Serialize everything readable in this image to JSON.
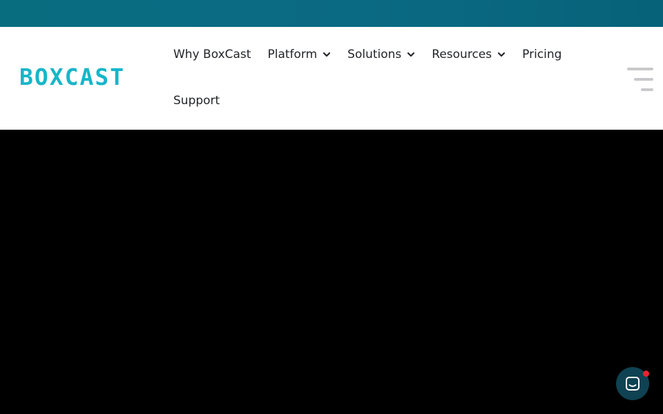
{
  "brand": {
    "logo_text": "BOXCAST",
    "accent_color": "#17b6c9",
    "top_strip_color": "#096d80"
  },
  "nav": {
    "items": [
      {
        "label": "Why BoxCast",
        "has_dropdown": false
      },
      {
        "label": "Platform",
        "has_dropdown": true
      },
      {
        "label": "Solutions",
        "has_dropdown": true
      },
      {
        "label": "Resources",
        "has_dropdown": true
      },
      {
        "label": "Pricing",
        "has_dropdown": false
      },
      {
        "label": "Support",
        "has_dropdown": false
      }
    ]
  },
  "icons": {
    "menu": "hamburger-menu-icon",
    "chat": "chat-bubble-icon",
    "dropdown": "chevron-down-icon"
  },
  "chat": {
    "badge_color": "#e5262f",
    "button_color": "#0f4252"
  }
}
